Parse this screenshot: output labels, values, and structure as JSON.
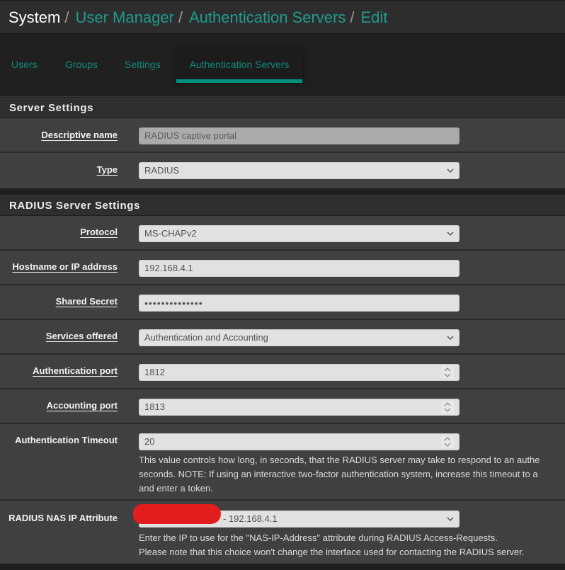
{
  "breadcrumb": {
    "root": "System",
    "items": [
      "User Manager",
      "Authentication Servers",
      "Edit"
    ],
    "separator": "/"
  },
  "tabs": [
    {
      "label": "Users",
      "active": false
    },
    {
      "label": "Groups",
      "active": false
    },
    {
      "label": "Settings",
      "active": false
    },
    {
      "label": "Authentication Servers",
      "active": true
    }
  ],
  "server_settings": {
    "title": "Server Settings",
    "descriptive_name": {
      "label": "Descriptive name",
      "value": "RADIUS captive portal",
      "disabled": true
    },
    "type": {
      "label": "Type",
      "value": "RADIUS"
    }
  },
  "radius_settings": {
    "title": "RADIUS Server Settings",
    "protocol": {
      "label": "Protocol",
      "value": "MS-CHAPv2"
    },
    "hostname": {
      "label": "Hostname or IP address",
      "value": "192.168.4.1"
    },
    "shared_secret": {
      "label": "Shared Secret",
      "value": "••••••••••••••"
    },
    "services_offered": {
      "label": "Services offered",
      "value": "Authentication and Accounting"
    },
    "auth_port": {
      "label": "Authentication port",
      "value": "1812"
    },
    "acct_port": {
      "label": "Accounting port",
      "value": "1813"
    },
    "auth_timeout": {
      "label": "Authentication Timeout",
      "value": "20",
      "help": [
        "This value controls how long, in seconds, that the RADIUS server may take to respond to an authe",
        "seconds. NOTE: If using an interactive two-factor authentication system, increase this timeout to a",
        "and enter a token."
      ]
    },
    "nas_ip": {
      "label": "RADIUS NAS IP Attribute",
      "value": "- 192.168.4.1",
      "redacted": true,
      "help": [
        "Enter the IP to use for the \"NAS-IP-Address\" attribute during RADIUS Access-Requests.",
        "Please note that this choice won't change the interface used for contacting the RADIUS server."
      ]
    }
  },
  "colors": {
    "accent": "#00917f",
    "link": "#1e9c8c",
    "row_bg": "#404040",
    "header_bg": "#2d2d2d",
    "redaction": "#e21d1d"
  }
}
